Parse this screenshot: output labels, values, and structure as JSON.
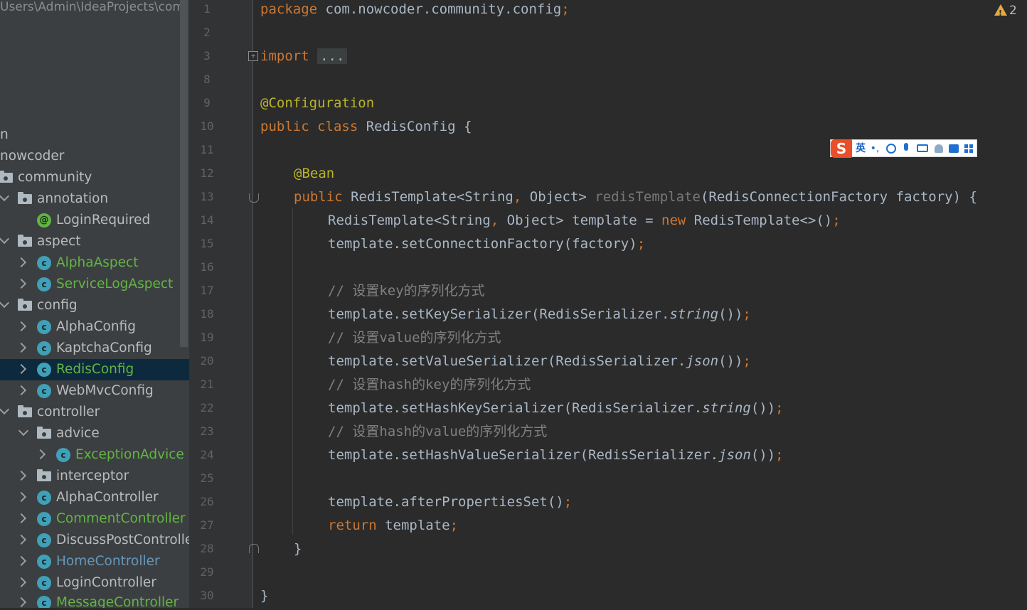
{
  "project_view": {
    "path": "Users\\Admin\\IdeaProjects\\com",
    "tree": [
      {
        "label": "n",
        "kind": "text"
      },
      {
        "label": "nowcoder",
        "kind": "text"
      },
      {
        "label": "community",
        "kind": "folder"
      },
      {
        "label": "annotation",
        "kind": "folder"
      },
      {
        "label": "LoginRequired",
        "kind": "annotation"
      },
      {
        "label": "aspect",
        "kind": "folder"
      },
      {
        "label": "AlphaAspect",
        "kind": "class"
      },
      {
        "label": "ServiceLogAspect",
        "kind": "class"
      },
      {
        "label": "config",
        "kind": "folder"
      },
      {
        "label": "AlphaConfig",
        "kind": "class"
      },
      {
        "label": "KaptchaConfig",
        "kind": "class"
      },
      {
        "label": "RedisConfig",
        "kind": "class",
        "selected": true
      },
      {
        "label": "WebMvcConfig",
        "kind": "class"
      },
      {
        "label": "controller",
        "kind": "folder"
      },
      {
        "label": "advice",
        "kind": "folder"
      },
      {
        "label": "ExceptionAdvice",
        "kind": "class"
      },
      {
        "label": "interceptor",
        "kind": "folder"
      },
      {
        "label": "AlphaController",
        "kind": "class"
      },
      {
        "label": "CommentController",
        "kind": "class"
      },
      {
        "label": "DiscussPostController",
        "kind": "class"
      },
      {
        "label": "HomeController",
        "kind": "class"
      },
      {
        "label": "LoginController",
        "kind": "class"
      },
      {
        "label": "MessageController",
        "kind": "class"
      }
    ]
  },
  "editor": {
    "line_numbers": [
      "1",
      "2",
      "3",
      "8",
      "9",
      "10",
      "11",
      "12",
      "13",
      "14",
      "15",
      "16",
      "17",
      "18",
      "19",
      "20",
      "21",
      "22",
      "23",
      "24",
      "25",
      "26",
      "27",
      "28",
      "29",
      "30"
    ],
    "lines": {
      "l1_kw": "package",
      "l1_rest": " com.nowcoder.community.config",
      "l1_semi": ";",
      "l3_kw": "import",
      "l3_dots": "...",
      "l9": "@Configuration",
      "l10_kw": "public class",
      "l10_name": " RedisConfig",
      "l10_brace": " {",
      "l12": "@Bean",
      "l13_kw": "public",
      "l13_type": " RedisTemplate<String",
      "l13_comma": ",",
      "l13_type2": " Object> ",
      "l13_method": "redisTemplate",
      "l13_params": "(RedisConnectionFactory factory) {",
      "l14_a": "RedisTemplate<String",
      "l14_comma": ",",
      "l14_b": " Object> template = ",
      "l14_new": "new",
      "l14_c": " RedisTemplate<>()",
      "l14_semi": ";",
      "l15_a": "template.setConnectionFactory(factory)",
      "l15_semi": ";",
      "l17": "// 设置key的序列化方式",
      "l18_a": "template.setKeySerializer(RedisSerializer.",
      "l18_it": "string",
      "l18_b": "())",
      "l18_semi": ";",
      "l19": "// 设置value的序列化方式",
      "l20_a": "template.setValueSerializer(RedisSerializer.",
      "l20_it": "json",
      "l20_b": "())",
      "l20_semi": ";",
      "l21": "// 设置hash的key的序列化方式",
      "l22_a": "template.setHashKeySerializer(RedisSerializer.",
      "l22_it": "string",
      "l22_b": "())",
      "l22_semi": ";",
      "l23": "// 设置hash的value的序列化方式",
      "l24_a": "template.setHashValueSerializer(RedisSerializer.",
      "l24_it": "json",
      "l24_b": "())",
      "l24_semi": ";",
      "l26_a": "template.afterPropertiesSet()",
      "l26_semi": ";",
      "l27_kw": "return",
      "l27_a": " template",
      "l27_semi": ";",
      "l28": "}",
      "l30": "}"
    }
  },
  "warnings": {
    "count": "2"
  },
  "ime_toolbar": {
    "lang": "英",
    "punct": "•,"
  },
  "colors": {
    "keyword": "#cc7832",
    "annotation": "#bbb529",
    "method": "#ffc66d",
    "comment": "#808080",
    "text": "#a9b7c6",
    "selected_row": "#0d293e"
  }
}
